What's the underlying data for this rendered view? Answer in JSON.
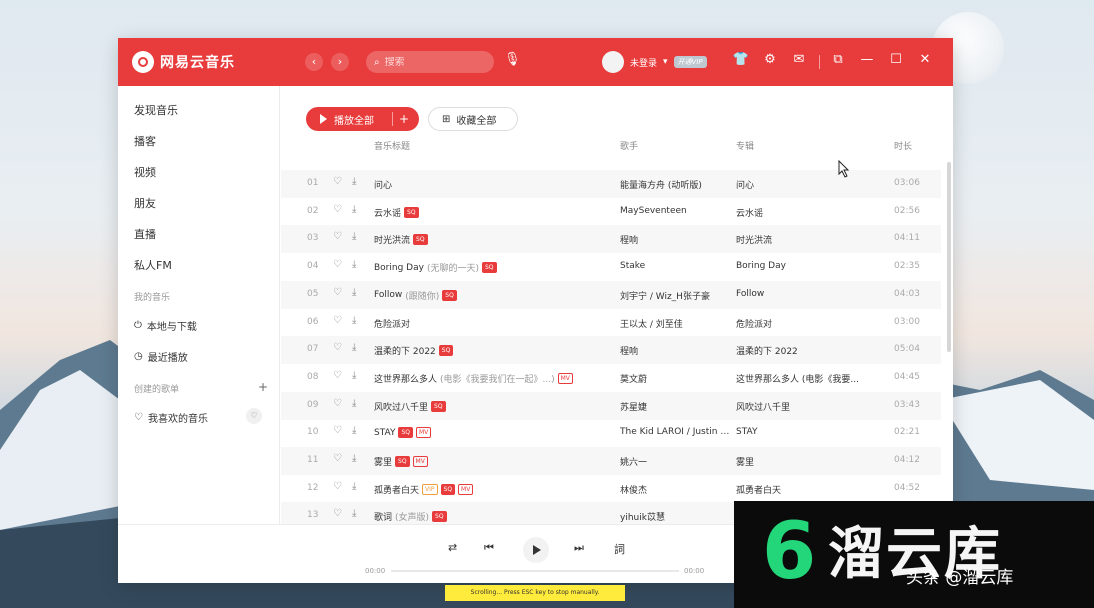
{
  "app": {
    "logo_text": "网易云音乐"
  },
  "header": {
    "search_placeholder": "搜索",
    "user_name": "未登录",
    "vip_label": "开通VIP"
  },
  "sidebar": {
    "items": [
      "发现音乐",
      "播客",
      "视频",
      "朋友",
      "直播",
      "私人FM"
    ],
    "my_music_label": "我的音乐",
    "my_music_items": [
      "本地与下载",
      "最近播放"
    ],
    "created_playlists_label": "创建的歌单",
    "liked_label": "我喜欢的音乐"
  },
  "toolbar": {
    "play_all_label": "播放全部",
    "collect_all_label": "收藏全部"
  },
  "table": {
    "headers": {
      "title": "音乐标题",
      "artist": "歌手",
      "album": "专辑",
      "duration": "时长"
    },
    "rows": [
      {
        "idx": "01",
        "title": "问心",
        "sub": "",
        "tags": [],
        "artist": "能量海方舟 (动听版)",
        "album": "问心",
        "dur": "03:06"
      },
      {
        "idx": "02",
        "title": "云水谣",
        "sub": "",
        "tags": [
          "SQ"
        ],
        "artist": "MaySeventeen",
        "album": "云水谣",
        "dur": "02:56"
      },
      {
        "idx": "03",
        "title": "时光洪流",
        "sub": "",
        "tags": [
          "SQ"
        ],
        "artist": "程响",
        "album": "时光洪流",
        "dur": "04:11"
      },
      {
        "idx": "04",
        "title": "Boring Day",
        "sub": "(无聊的一天)",
        "tags": [
          "SQ"
        ],
        "artist": "Stake",
        "album": "Boring Day",
        "dur": "02:35"
      },
      {
        "idx": "05",
        "title": "Follow",
        "sub": "(跟随你)",
        "tags": [
          "SQ"
        ],
        "artist": "刘宇宁 / Wiz_H张子豪",
        "album": "Follow",
        "dur": "04:03"
      },
      {
        "idx": "06",
        "title": "危险派对",
        "sub": "",
        "tags": [],
        "artist": "王以太 / 刘至佳",
        "album": "危险派对",
        "dur": "03:00"
      },
      {
        "idx": "07",
        "title": "温柔的下 2022",
        "sub": "",
        "tags": [
          "SQ"
        ],
        "artist": "程响",
        "album": "温柔的下 2022",
        "dur": "05:04"
      },
      {
        "idx": "08",
        "title": "这世界那么多人",
        "sub": "(电影《我要我们在一起》...)",
        "tags": [
          "MV"
        ],
        "artist": "莫文蔚",
        "album": "这世界那么多人 (电影《我要...",
        "dur": "04:45"
      },
      {
        "idx": "09",
        "title": "风吹过八千里",
        "sub": "",
        "tags": [
          "SQ"
        ],
        "artist": "苏星婕",
        "album": "风吹过八千里",
        "dur": "03:43"
      },
      {
        "idx": "10",
        "title": "STAY",
        "sub": "",
        "tags": [
          "SQ",
          "MV"
        ],
        "artist": "The Kid LAROI / Justin Bieber",
        "album": "STAY",
        "dur": "02:21"
      },
      {
        "idx": "11",
        "title": "雾里",
        "sub": "",
        "tags": [
          "SQ",
          "MV"
        ],
        "artist": "姚六一",
        "album": "雾里",
        "dur": "04:12"
      },
      {
        "idx": "12",
        "title": "孤勇者白天",
        "sub": "",
        "tags": [
          "VIP",
          "SQ",
          "MV"
        ],
        "artist": "林俊杰",
        "album": "孤勇者白天",
        "dur": "04:52"
      },
      {
        "idx": "13",
        "title": "歌词",
        "sub": "(女声版)",
        "tags": [
          "SQ"
        ],
        "artist": "yihuik苡慧",
        "album": "",
        "dur": ""
      }
    ]
  },
  "player": {
    "time_current": "00:00",
    "time_total": "00:00"
  },
  "watermark": {
    "logo_char": "6",
    "text": "溜云库",
    "sub": "头条 @溜云库"
  },
  "status_bar": {
    "text": "Scrolling... Press ESC key to stop manually."
  },
  "colors": {
    "accent": "#e83b3b",
    "brand_green": "#23d67a"
  }
}
